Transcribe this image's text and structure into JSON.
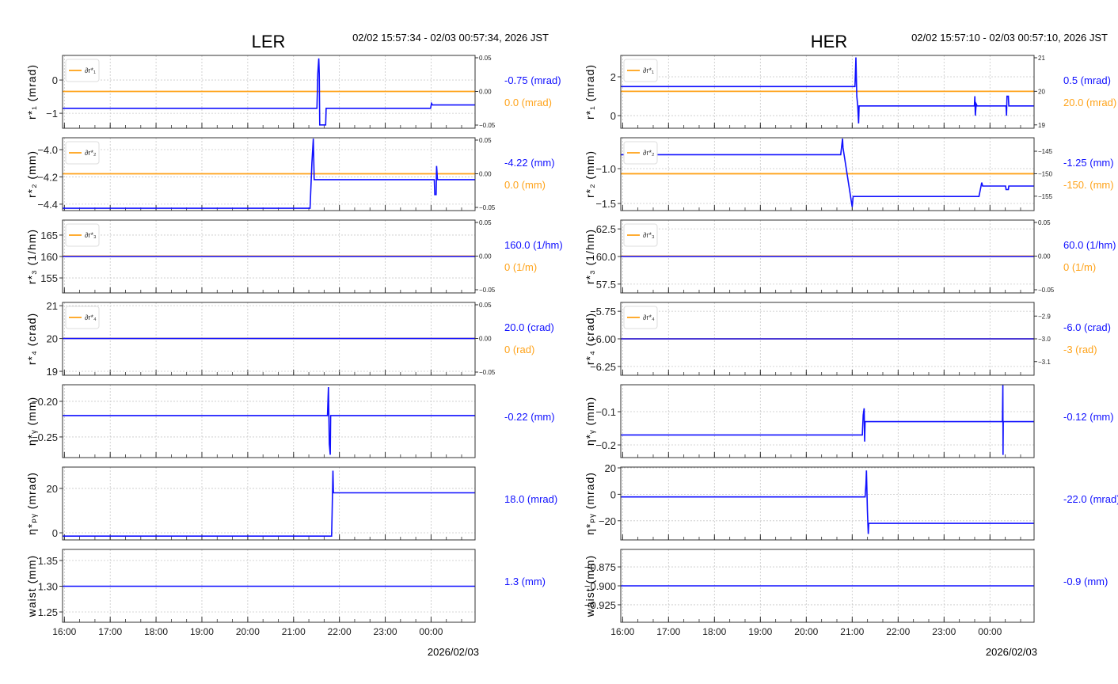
{
  "colors": {
    "series": "#1010ff",
    "setpoint": "#ffa31a",
    "grid": "#c8c8c8"
  },
  "chart_data": [
    {
      "type": "line",
      "title": "LER",
      "time_range": "02/02 15:57:34 - 02/03 00:57:34, 2026 JST",
      "date_label": "2026/02/03",
      "x_unit": "hours after 16:00",
      "xlim": [
        -0.04,
        8.96
      ],
      "xticks": [
        "16:00",
        "17:00",
        "18:00",
        "19:00",
        "20:00",
        "21:00",
        "22:00",
        "23:00",
        "00:00"
      ],
      "panels": [
        {
          "ylabel": "r*₁ (mrad)",
          "ylim": [
            -1.45,
            0.74
          ],
          "yticks": [
            0,
            -1
          ],
          "ytick_labels": [
            "0",
            "−1"
          ],
          "right": {
            "ylim": [
              -0.0547,
              0.0535
            ],
            "ticks": [
              0.05,
              0,
              -0.05
            ],
            "tick_labels": [
              "0.05",
              "0.00",
              "−0.05"
            ],
            "setpoint": 0,
            "legend": "∂r*₁"
          },
          "value": "-0.75 (mrad)",
          "setpoint_value": "0.0 (mrad)",
          "series": [
            [
              -0.04,
              -0.85
            ],
            [
              5.51,
              -0.85
            ],
            [
              5.53,
              0.2
            ],
            [
              5.55,
              0.65
            ],
            [
              5.56,
              0.2
            ],
            [
              5.57,
              -1.35
            ],
            [
              5.7,
              -1.35
            ],
            [
              5.71,
              -0.85
            ],
            [
              7.99,
              -0.85
            ],
            [
              8.01,
              -0.7
            ],
            [
              8.03,
              -0.75
            ],
            [
              8.96,
              -0.75
            ]
          ]
        },
        {
          "ylabel": "r*₂ (mm)",
          "ylim": [
            -4.447,
            -3.913
          ],
          "yticks": [
            -4.0,
            -4.2,
            -4.4
          ],
          "ytick_labels": [
            "−4.0",
            "−4.2",
            "−4.4"
          ],
          "right": {
            "ylim": [
              -0.0547,
              0.0535
            ],
            "ticks": [
              0.05,
              0,
              -0.05
            ],
            "tick_labels": [
              "0.05",
              "0.00",
              "−0.05"
            ],
            "setpoint": 0,
            "legend": "∂r*₂"
          },
          "value": "-4.22 (mm)",
          "setpoint_value": "0.0 (mm)",
          "series": [
            [
              -0.04,
              -4.43
            ],
            [
              5.36,
              -4.43
            ],
            [
              5.4,
              -4.1
            ],
            [
              5.43,
              -3.92
            ],
            [
              5.45,
              -4.22
            ],
            [
              8.07,
              -4.22
            ],
            [
              8.08,
              -4.33
            ],
            [
              8.11,
              -4.33
            ],
            [
              8.12,
              -4.12
            ],
            [
              8.14,
              -4.22
            ],
            [
              8.96,
              -4.22
            ]
          ]
        },
        {
          "ylabel": "r*₃ (1/hm)",
          "ylim": [
            151.5,
            168.5
          ],
          "yticks": [
            165,
            160,
            155
          ],
          "ytick_labels": [
            "165",
            "160",
            "155"
          ],
          "right": {
            "ylim": [
              -0.0547,
              0.0535
            ],
            "ticks": [
              0.05,
              0,
              -0.05
            ],
            "tick_labels": [
              "0.05",
              "0.00",
              "−0.05"
            ],
            "setpoint": 0,
            "legend": "∂r*₃"
          },
          "value": "160.0 (1/hm)",
          "setpoint_value": "0 (1/m)",
          "series": [
            [
              -0.04,
              160
            ],
            [
              8.96,
              160
            ]
          ]
        },
        {
          "ylabel": "r*₄ (crad)",
          "ylim": [
            18.88,
            21.1
          ],
          "yticks": [
            21,
            20,
            19
          ],
          "ytick_labels": [
            "21",
            "20",
            "19"
          ],
          "right": {
            "ylim": [
              -0.0547,
              0.0535
            ],
            "ticks": [
              0.05,
              0,
              -0.05
            ],
            "tick_labels": [
              "0.05",
              "0.00",
              "−0.05"
            ],
            "setpoint": 0,
            "legend": "∂r*₄"
          },
          "value": "20.0 (crad)",
          "setpoint_value": "0 (rad)",
          "series": [
            [
              -0.04,
              20
            ],
            [
              8.96,
              20
            ]
          ]
        },
        {
          "ylabel": "η*ᵧ (mm)",
          "ylim": [
            -0.279,
            -0.1767
          ],
          "yticks": [
            -0.2,
            -0.25
          ],
          "ytick_labels": [
            "−0.20",
            "−0.25"
          ],
          "value": "-0.22 (mm)",
          "series": [
            [
              -0.04,
              -0.22
            ],
            [
              5.74,
              -0.22
            ],
            [
              5.76,
              -0.18
            ],
            [
              5.78,
              -0.26
            ],
            [
              5.8,
              -0.275
            ],
            [
              5.81,
              -0.22
            ],
            [
              8.96,
              -0.22
            ]
          ]
        },
        {
          "ylabel": "η*ₚᵧ (mrad)",
          "ylim": [
            -3.2,
            29.6
          ],
          "yticks": [
            20,
            0
          ],
          "ytick_labels": [
            "20",
            "0"
          ],
          "value": "18.0 (mrad)",
          "series": [
            [
              -0.04,
              -1.5
            ],
            [
              5.83,
              -1.5
            ],
            [
              5.84,
              8
            ],
            [
              5.86,
              28
            ],
            [
              5.87,
              18
            ],
            [
              8.96,
              18
            ]
          ]
        },
        {
          "ylabel": "waist (mm)",
          "ylim": [
            1.23,
            1.3715
          ],
          "yticks": [
            1.35,
            1.3,
            1.25
          ],
          "ytick_labels": [
            "1.35",
            "1.30",
            "1.25"
          ],
          "value": "1.3 (mm)",
          "series": [
            [
              -0.04,
              1.3
            ],
            [
              8.96,
              1.3
            ]
          ]
        }
      ]
    },
    {
      "type": "line",
      "title": "HER",
      "time_range": "02/02 15:57:10 - 02/03 00:57:10, 2026 JST",
      "date_label": "2026/02/03",
      "x_unit": "hours after 16:00",
      "xlim": [
        -0.04,
        8.96
      ],
      "xticks": [
        "16:00",
        "17:00",
        "18:00",
        "19:00",
        "20:00",
        "21:00",
        "22:00",
        "23:00",
        "00:00"
      ],
      "panels": [
        {
          "ylabel": "r*₁ (mrad)",
          "ylim": [
            -0.65,
            3.1
          ],
          "yticks": [
            2,
            0
          ],
          "ytick_labels": [
            "2",
            "0"
          ],
          "right": {
            "ylim": [
              18.9,
              21.07
            ],
            "ticks": [
              21,
              20,
              19
            ],
            "tick_labels": [
              "21",
              "20",
              "19"
            ],
            "setpoint": 20,
            "legend": "∂r*₁"
          },
          "value": "0.5 (mrad)",
          "setpoint_value": "20.0 (mrad)",
          "series": [
            [
              -0.04,
              1.5
            ],
            [
              5.06,
              1.5
            ],
            [
              5.08,
              3.0
            ],
            [
              5.1,
              1.0
            ],
            [
              5.12,
              0.5
            ],
            [
              5.14,
              -0.4
            ],
            [
              5.15,
              0.5
            ],
            [
              7.66,
              0.5
            ],
            [
              7.67,
              1.0
            ],
            [
              7.68,
              0.0
            ],
            [
              7.7,
              0.6
            ],
            [
              7.72,
              0.5
            ],
            [
              8.35,
              0.5
            ],
            [
              8.36,
              0
            ],
            [
              8.37,
              1.0
            ],
            [
              8.4,
              1.0
            ],
            [
              8.41,
              0.5
            ],
            [
              8.96,
              0.5
            ]
          ]
        },
        {
          "ylabel": "r*₂ (mm)",
          "ylim": [
            -1.602,
            -0.557
          ],
          "yticks": [
            -1.0,
            -1.5
          ],
          "ytick_labels": [
            "−1.0",
            "−1.5"
          ],
          "right": {
            "ylim": [
              -158.2,
              -142.0
            ],
            "ticks": [
              -145,
              -150,
              -155
            ],
            "tick_labels": [
              "−145",
              "−150",
              "−155"
            ],
            "setpoint": -150,
            "legend": "∂r*₂"
          },
          "value": "-1.25 (mm)",
          "setpoint_value": "-150. (mm)",
          "series": [
            [
              -0.04,
              -0.8
            ],
            [
              4.75,
              -0.8
            ],
            [
              4.79,
              -0.57
            ],
            [
              4.8,
              -0.7
            ],
            [
              5.0,
              -1.55
            ],
            [
              5.02,
              -1.4
            ],
            [
              7.76,
              -1.4
            ],
            [
              7.82,
              -1.2
            ],
            [
              7.84,
              -1.25
            ],
            [
              8.34,
              -1.25
            ],
            [
              8.35,
              -1.3
            ],
            [
              8.4,
              -1.3
            ],
            [
              8.41,
              -1.25
            ],
            [
              8.96,
              -1.25
            ]
          ]
        },
        {
          "ylabel": "r*₃ (1/hm)",
          "ylim": [
            56.7,
            63.3
          ],
          "yticks": [
            62.5,
            60,
            57.5
          ],
          "ytick_labels": [
            "62.5",
            "60.0",
            "57.5"
          ],
          "right": {
            "ylim": [
              -0.0547,
              0.0535
            ],
            "ticks": [
              0.05,
              0,
              -0.05
            ],
            "tick_labels": [
              "0.05",
              "0.00",
              "−0.05"
            ],
            "setpoint": 0,
            "legend": "∂r*₃"
          },
          "value": "60.0 (1/hm)",
          "setpoint_value": "0 (1/m)",
          "series": [
            [
              -0.04,
              60
            ],
            [
              8.96,
              60
            ]
          ]
        },
        {
          "ylabel": "r*₄ (crad)",
          "ylim": [
            -6.33,
            -5.67
          ],
          "yticks": [
            -5.75,
            -6.0,
            -6.25
          ],
          "ytick_labels": [
            "−5.75",
            "−6.00",
            "−6.25"
          ],
          "right": {
            "ylim": [
              -3.16,
              -2.84
            ],
            "ticks": [
              -2.9,
              -3.0,
              -3.1
            ],
            "tick_labels": [
              "−2.9",
              "−3.0",
              "−3.1"
            ],
            "setpoint": -3,
            "legend": "∂r*₄"
          },
          "value": "-6.0 (crad)",
          "setpoint_value": "-3 (rad)",
          "series": [
            [
              -0.04,
              -6
            ],
            [
              8.96,
              -6
            ]
          ]
        },
        {
          "ylabel": "η*ᵧ (mm)",
          "ylim": [
            -0.238,
            -0.019
          ],
          "yticks": [
            -0.1,
            -0.2
          ],
          "ytick_labels": [
            "−0.1",
            "−0.2"
          ],
          "value": "-0.12 (mm)",
          "series": [
            [
              -0.04,
              -0.17
            ],
            [
              5.22,
              -0.17
            ],
            [
              5.24,
              -0.11
            ],
            [
              5.26,
              -0.09
            ],
            [
              5.27,
              -0.19
            ],
            [
              5.28,
              -0.13
            ],
            [
              8.27,
              -0.13
            ],
            [
              8.28,
              -0.02
            ],
            [
              8.285,
              -0.23
            ],
            [
              8.29,
              -0.13
            ],
            [
              8.96,
              -0.13
            ]
          ]
        },
        {
          "ylabel": "η*ₚᵧ (mrad)",
          "ylim": [
            -34.5,
            20.6
          ],
          "yticks": [
            20,
            0,
            -20
          ],
          "ytick_labels": [
            "20",
            "0",
            "−20"
          ],
          "value": "-22.0 (mrad)",
          "series": [
            [
              -0.04,
              -2
            ],
            [
              5.28,
              -2
            ],
            [
              5.3,
              8
            ],
            [
              5.31,
              18
            ],
            [
              5.33,
              -12
            ],
            [
              5.35,
              -30
            ],
            [
              5.36,
              -22
            ],
            [
              8.96,
              -22
            ]
          ]
        },
        {
          "ylabel": "waist (mm)",
          "ylim": [
            -0.948,
            -0.852
          ],
          "yticks": [
            -0.875,
            -0.9,
            -0.925
          ],
          "ytick_labels": [
            "−0.875",
            "−0.900",
            "−0.925"
          ],
          "value": "-0.9 (mm)",
          "series": [
            [
              -0.04,
              -0.9
            ],
            [
              8.96,
              -0.9
            ]
          ]
        }
      ]
    }
  ]
}
